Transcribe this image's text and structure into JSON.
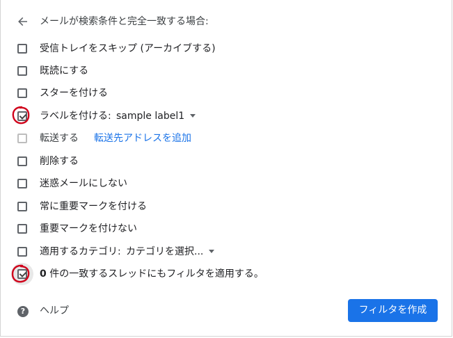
{
  "header": {
    "title": "メールが検索条件と完全一致する場合:"
  },
  "options": [
    {
      "label": "受信トレイをスキップ (アーカイブする)",
      "checked": false
    },
    {
      "label": "既読にする",
      "checked": false
    },
    {
      "label": "スターを付ける",
      "checked": false
    },
    {
      "label": "ラベルを付ける:",
      "checked": true,
      "dropdown_value": "sample label1"
    },
    {
      "label": "転送する",
      "checked": false,
      "disabled": true,
      "link": "転送先アドレスを追加"
    },
    {
      "label": "削除する",
      "checked": false
    },
    {
      "label": "迷惑メールにしない",
      "checked": false
    },
    {
      "label": "常に重要マークを付ける",
      "checked": false
    },
    {
      "label": "重要マークを付けない",
      "checked": false
    },
    {
      "label": "適用するカテゴリ:",
      "checked": false,
      "dropdown_value": "カテゴリを選択..."
    }
  ],
  "apply_existing": {
    "count": "0",
    "label": " 件の一致するスレッドにもフィルタを適用する。",
    "checked": true
  },
  "footer": {
    "help_label": "ヘルプ",
    "help_icon_glyph": "?",
    "create_button_label": "フィルタを作成"
  },
  "colors": {
    "accent": "#1a73e8",
    "annotation": "#d0021b"
  }
}
